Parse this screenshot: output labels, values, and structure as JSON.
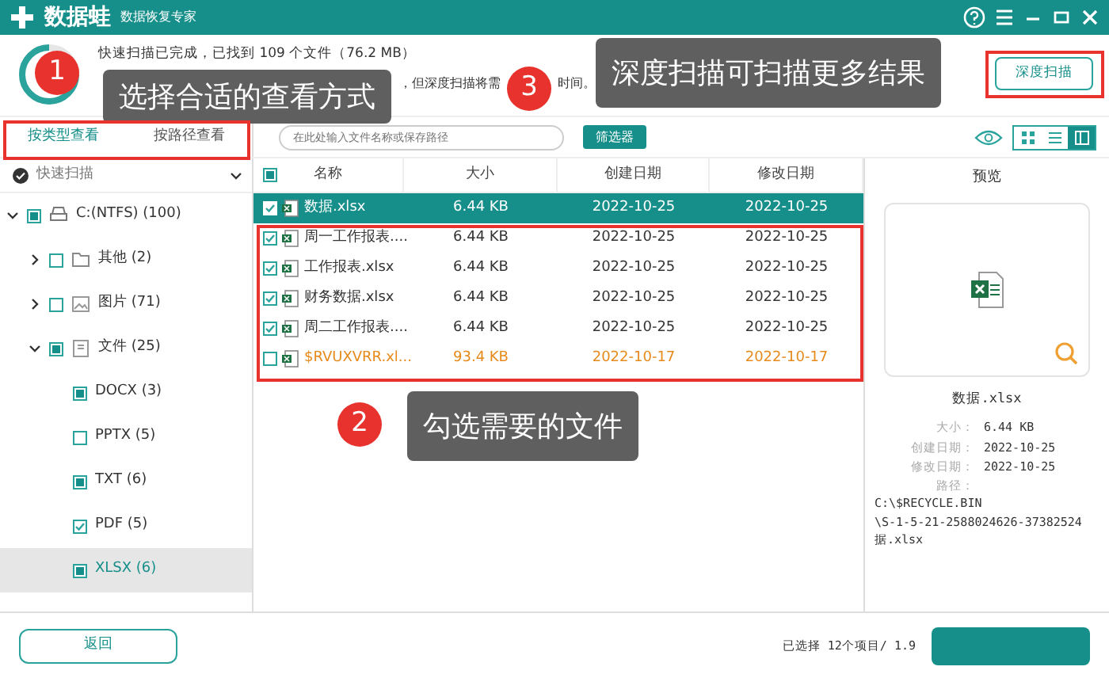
{
  "titlebar": {
    "app_name": "数据蛙",
    "subtitle": "数据恢复专家"
  },
  "scan_status": {
    "line_1": "快速扫描已完成，已找到 109 个文件（76.2 MB）",
    "line_2_parts": [
      "，但深度扫描将需",
      "时间。"
    ]
  },
  "deep_scan_button": "深度扫描",
  "view_tabs": [
    {
      "label": "按类型查看",
      "selected": true
    },
    {
      "label": "按路径查看",
      "selected": false
    }
  ],
  "search": {
    "placeholder": "在此处输入文件名称或保存路径"
  },
  "filter_button": "筛选器",
  "view_modes": [
    {
      "kind": "grid",
      "selected": false
    },
    {
      "kind": "list",
      "selected": false
    },
    {
      "kind": "detail",
      "selected": true
    }
  ],
  "tree": {
    "label": "快速扫描",
    "expanded": true,
    "items": [
      {
        "label": "C:(NTFS) (100)",
        "kind": "drive",
        "checked": false,
        "partial": true,
        "expanded": true,
        "selected": false,
        "children": [
          {
            "label": "其他 (2)",
            "kind": "folder",
            "checked": false,
            "partial": false,
            "expanded": false,
            "selected": false
          },
          {
            "label": "图片 (71)",
            "kind": "image",
            "checked": false,
            "partial": false,
            "expanded": false,
            "selected": false
          },
          {
            "label": "文件 (25)",
            "kind": "document",
            "checked": false,
            "partial": true,
            "expanded": true,
            "selected": false,
            "children": [
              {
                "label": "DOCX (3)",
                "kind": "type",
                "checked": false,
                "partial": true,
                "selected": false
              },
              {
                "label": "PPTX (5)",
                "kind": "type",
                "checked": false,
                "partial": false,
                "selected": false
              },
              {
                "label": "TXT (6)",
                "kind": "type",
                "checked": false,
                "partial": true,
                "selected": false
              },
              {
                "label": "PDF (5)",
                "kind": "type",
                "checked": true,
                "partial": false,
                "selected": false
              },
              {
                "label": "XLSX (6)",
                "kind": "type",
                "checked": false,
                "partial": true,
                "selected": true
              }
            ]
          }
        ]
      }
    ]
  },
  "table": {
    "columns": [
      "名称",
      "大小",
      "创建日期",
      "修改日期"
    ],
    "header_checked": false,
    "header_partial": true,
    "rows": [
      {
        "name": "数据.xlsx",
        "size": "6.44 KB",
        "created": "2022-10-25",
        "modified": "2022-10-25",
        "checked": true,
        "selected": true,
        "deleted": false
      },
      {
        "name": "周一工作报表....",
        "size": "6.44 KB",
        "created": "2022-10-25",
        "modified": "2022-10-25",
        "checked": true,
        "selected": false,
        "deleted": false
      },
      {
        "name": "工作报表.xlsx",
        "size": "6.44 KB",
        "created": "2022-10-25",
        "modified": "2022-10-25",
        "checked": true,
        "selected": false,
        "deleted": false
      },
      {
        "name": "财务数据.xlsx",
        "size": "6.44 KB",
        "created": "2022-10-25",
        "modified": "2022-10-25",
        "checked": true,
        "selected": false,
        "deleted": false
      },
      {
        "name": "周二工作报表....",
        "size": "6.44 KB",
        "created": "2022-10-25",
        "modified": "2022-10-25",
        "checked": true,
        "selected": false,
        "deleted": false
      },
      {
        "name": "$RVUXVRR.xl...",
        "size": "93.4 KB",
        "created": "2022-10-17",
        "modified": "2022-10-17",
        "checked": false,
        "selected": false,
        "deleted": true
      }
    ]
  },
  "preview": {
    "title": "预览",
    "file_name": "数据.xlsx",
    "fields": [
      {
        "label": "大小：",
        "value": "6.44 KB"
      },
      {
        "label": "创建日期：",
        "value": "2022-10-25"
      },
      {
        "label": "修改日期：",
        "value": "2022-10-25"
      },
      {
        "label": "路径："
      }
    ],
    "path_lines": [
      "C:\\$RECYCLE.BIN",
      "\\S-1-5-21-2588024626-37382524",
      "据.xlsx"
    ]
  },
  "back_button": "返回",
  "selection_summary": "已选择 12个项目/ 1.9",
  "annotations": [
    {
      "number": "1",
      "text": "选择合适的查看方式"
    },
    {
      "number": "2",
      "text": "勾选需要的文件"
    },
    {
      "number": "3",
      "text": "深度扫描可扫描更多结果"
    }
  ]
}
